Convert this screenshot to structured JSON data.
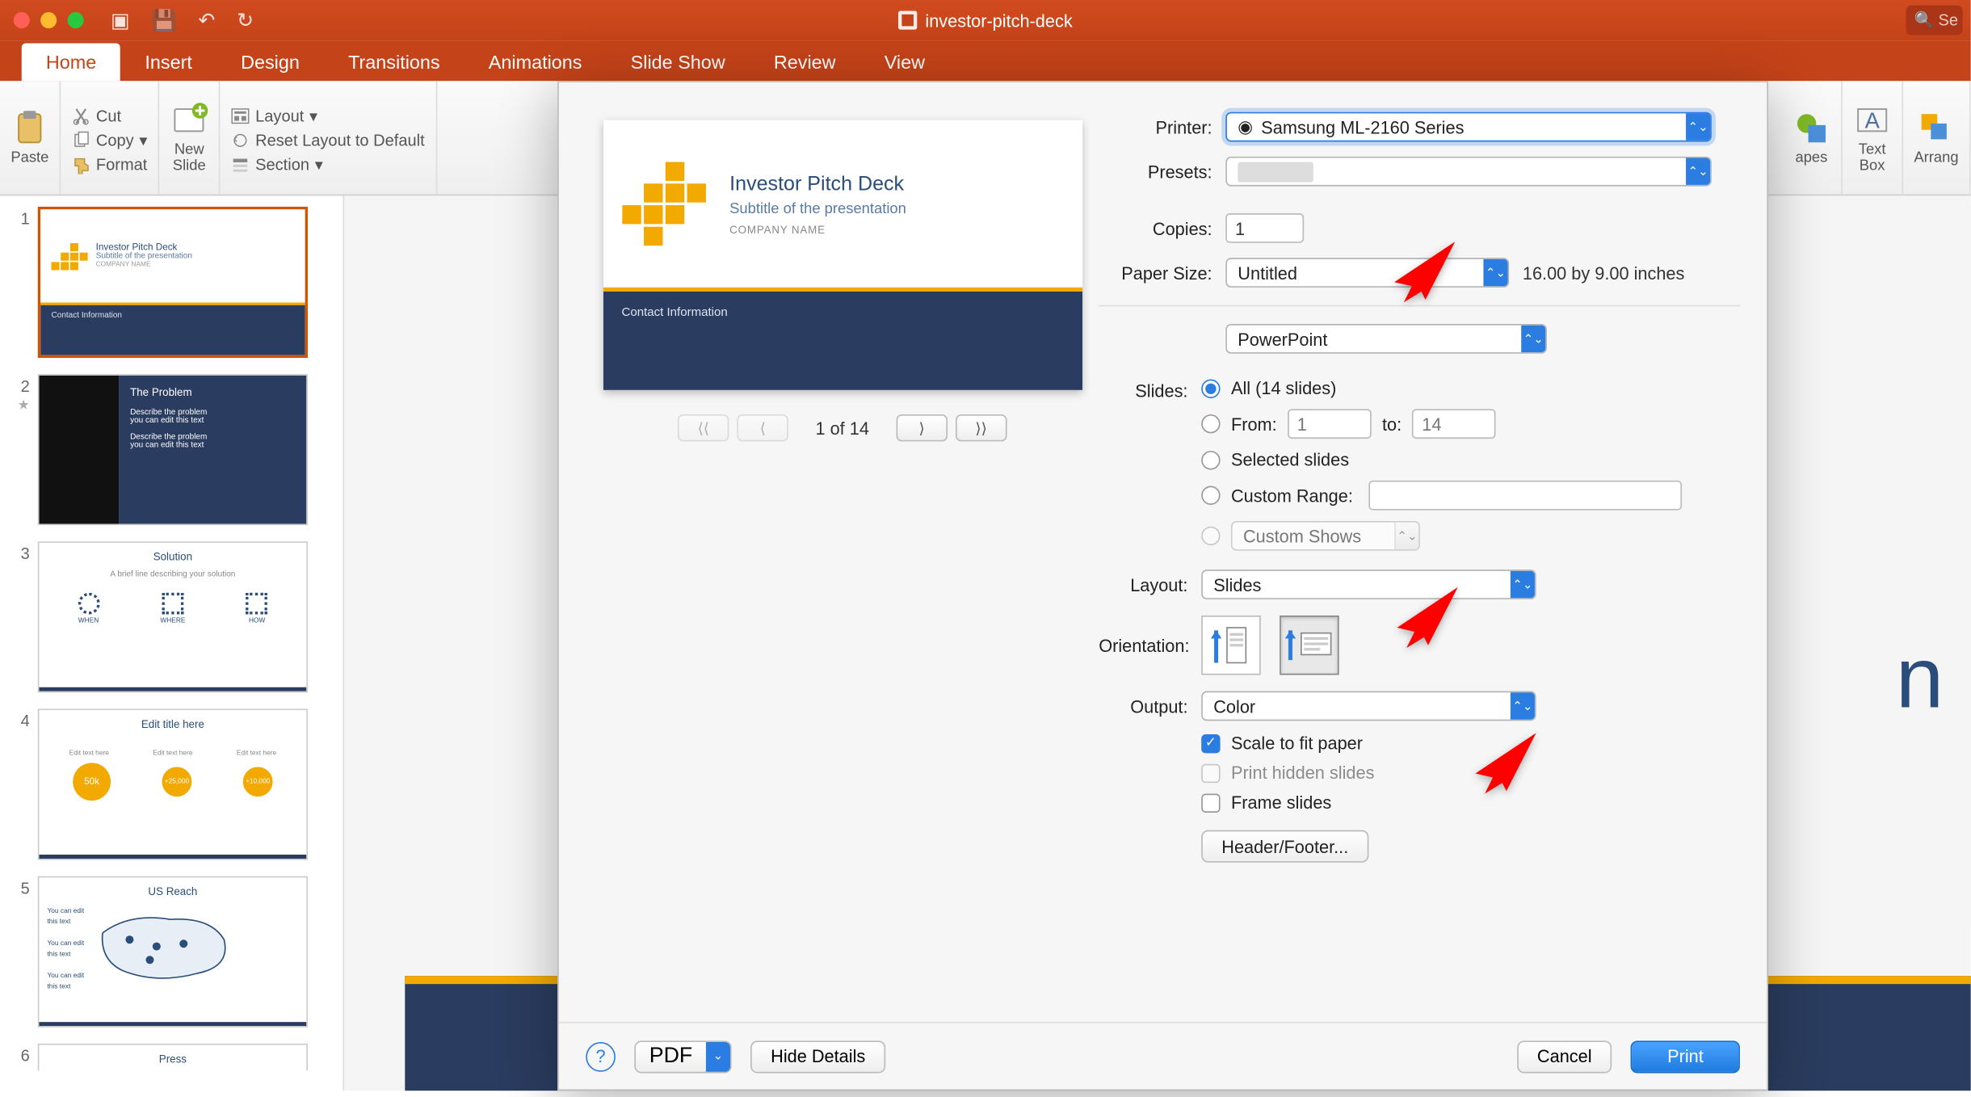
{
  "window": {
    "title": "investor-pitch-deck",
    "search_placeholder": "Se"
  },
  "tabs": [
    "Home",
    "Insert",
    "Design",
    "Transitions",
    "Animations",
    "Slide Show",
    "Review",
    "View"
  ],
  "ribbon": {
    "paste": "Paste",
    "cut": "Cut",
    "copy": "Copy",
    "format": "Format",
    "new_slide": "New\nSlide",
    "layout": "Layout",
    "reset_layout": "Reset Layout to Default",
    "section": "Section",
    "shapes": "apes",
    "textbox": "Text\nBox",
    "arrange": "Arrang"
  },
  "thumbnails": [
    {
      "n": 1,
      "title": "Investor Pitch Deck",
      "sub": "Subtitle of the presentation",
      "selected": true
    },
    {
      "n": 2,
      "title": "The Problem",
      "sub": "Describe the problem\nyou can edit this text",
      "starred": true
    },
    {
      "n": 3,
      "title": "Solution",
      "sub": "A brief line describing your solution"
    },
    {
      "n": 4,
      "title": "Edit title here"
    },
    {
      "n": 5,
      "title": "US Reach"
    },
    {
      "n": 6,
      "title": "Press"
    }
  ],
  "preview": {
    "title": "Investor Pitch Deck",
    "subtitle": "Subtitle of the presentation",
    "company": "COMPANY NAME",
    "footer": "Contact Information",
    "page": "1 of 14"
  },
  "print": {
    "labels": {
      "printer": "Printer:",
      "presets": "Presets:",
      "copies": "Copies:",
      "paper_size": "Paper Size:",
      "slides": "Slides:",
      "layout": "Layout:",
      "orientation": "Orientation:",
      "output": "Output:"
    },
    "printer": "Samsung ML-2160 Series",
    "copies": "1",
    "paper_size": "Untitled",
    "paper_dims": "16.00 by 9.00 inches",
    "app_menu": "PowerPoint",
    "slides": {
      "all": "All  (14 slides)",
      "from": "From:",
      "from_val": "1",
      "to": "to:",
      "to_val": "14",
      "selected": "Selected slides",
      "custom_range": "Custom Range:",
      "custom_shows": "Custom Shows"
    },
    "layout": "Slides",
    "output": "Color",
    "scale": "Scale to fit paper",
    "hidden": "Print hidden slides",
    "frame": "Frame slides",
    "header_footer": "Header/Footer...",
    "pdf": "PDF",
    "hide_details": "Hide Details",
    "cancel": "Cancel",
    "print_btn": "Print"
  }
}
